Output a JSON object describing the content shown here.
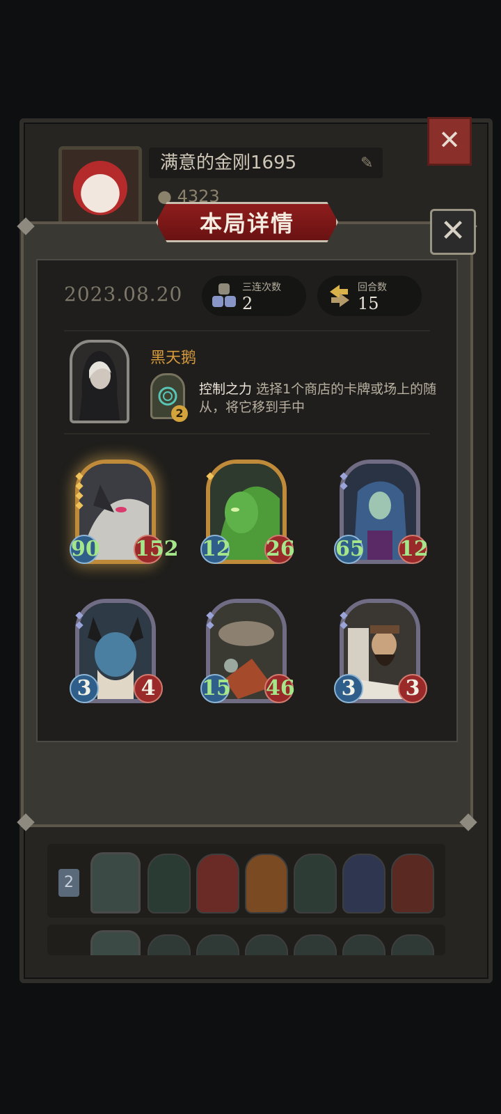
{
  "profile": {
    "player_name": "满意的金刚1695",
    "coins": "4323"
  },
  "dialog": {
    "title": "本局详情",
    "date": "2023.08.20",
    "triples": {
      "label": "三连次数",
      "value": "2"
    },
    "turns": {
      "label": "回合数",
      "value": "15"
    }
  },
  "hero": {
    "name": "黑天鹅",
    "power_name": "控制之力",
    "power_desc": " 选择1个商店的卡牌或场上的随从，将它移到手中",
    "power_cost": "2"
  },
  "minions": [
    {
      "attack": "90",
      "health": "152",
      "frame": "gold",
      "glow": true,
      "art": "dragon"
    },
    {
      "attack": "12",
      "health": "26",
      "frame": "gold",
      "glow": false,
      "art": "dryad"
    },
    {
      "attack": "65",
      "health": "12",
      "frame": "silver",
      "glow": false,
      "art": "elf"
    },
    {
      "attack": "3",
      "health": "4",
      "frame": "silver",
      "glow": false,
      "art": "demon"
    },
    {
      "attack": "15",
      "health": "46",
      "frame": "silver",
      "glow": false,
      "art": "airship"
    },
    {
      "attack": "3",
      "health": "3",
      "frame": "silver",
      "glow": false,
      "art": "scholar"
    }
  ],
  "history": {
    "row1": {
      "rank": "2"
    }
  },
  "colors": {
    "accent_red": "#8e1d1d",
    "hero_name": "#d59a3b",
    "attack_blue": "#2f5e8b",
    "health_red": "#9a2a2a",
    "buffed_green": "#a6e68a"
  },
  "icons": {
    "close": "close-icon",
    "edit": "pencil-icon",
    "coin": "coin-icon",
    "triple": "triple-icon",
    "turn": "turn-arrows-icon"
  }
}
